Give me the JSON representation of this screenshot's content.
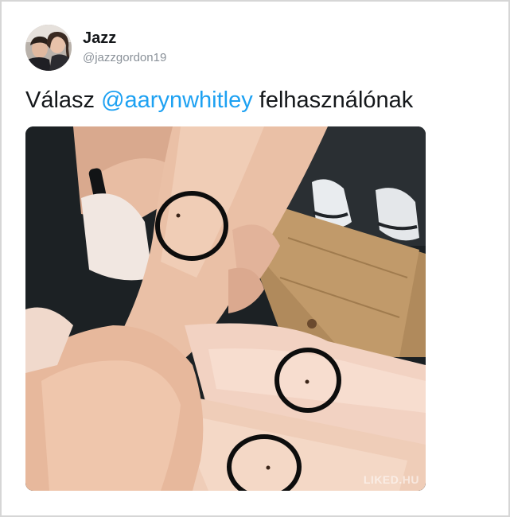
{
  "tweet": {
    "display_name": "Jazz",
    "handle": "@jazzgordon19",
    "reply_prefix": "Válasz",
    "reply_mention": "@aarynwhitley",
    "reply_suffix": "felhasználónak"
  },
  "media": {
    "watermark": "LIKED.HU"
  },
  "colors": {
    "mention": "#1da1f2",
    "text": "#14171a",
    "handle": "#8a9199",
    "frame_border": "#d6d6d6"
  }
}
